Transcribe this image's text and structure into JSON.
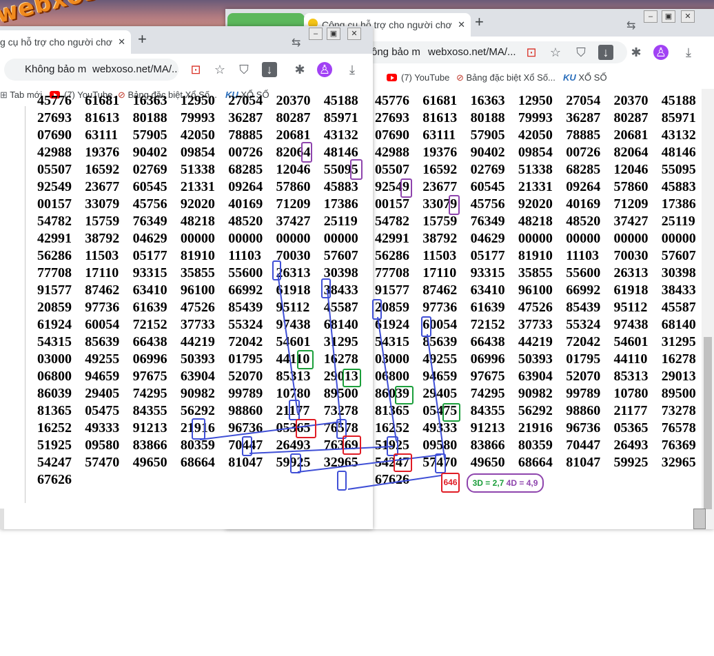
{
  "watermark": "webxoso.net",
  "back_window": {
    "tab_title": "Công cụ hỗ trợ cho người chơ",
    "tab_close": "✕",
    "new_tab": "+",
    "omnibox_left": "ông bảo m",
    "url": "webxoso.net/MA/...",
    "bookmarks": [
      "(7) YouTube",
      "Bảng đặc biệt Xổ Số...",
      "XỔ SỐ"
    ],
    "bookmark_prefix": "s"
  },
  "front_window": {
    "tab_title": "g cụ hỗ trợ cho người chơ",
    "tab_close": "✕",
    "new_tab": "+",
    "security": "Không bảo m",
    "url": "webxoso.net/MA/...",
    "bookmarks": [
      "Tab mới",
      "(7) YouTube",
      "Bảng đặc biệt Xổ Số...",
      "XỔ SỐ"
    ]
  },
  "left_grid": {
    "rows": [
      [
        "45776",
        "61681",
        "16363",
        "12950",
        "27054",
        "20370",
        "45188"
      ],
      [
        "27693",
        "81613",
        "80188",
        "79993",
        "36287",
        "80287",
        "85971"
      ],
      [
        "07690",
        "63111",
        "57905",
        "42050",
        "78885",
        "20681",
        "43132"
      ],
      [
        "42988",
        "19376",
        "90402",
        "09854",
        "00726",
        "82064",
        "48146"
      ],
      [
        "05507",
        "16592",
        "02769",
        "51338",
        "68285",
        "12046",
        "55095"
      ],
      [
        "92549",
        "23677",
        "60545",
        "21331",
        "09264",
        "57860",
        "45883"
      ],
      [
        "00157",
        "33079",
        "45756",
        "92020",
        "40169",
        "71209",
        "17386"
      ],
      [
        "54782",
        "15759",
        "76349",
        "48218",
        "48520",
        "37427",
        "25119"
      ],
      [
        "42991",
        "38792",
        "04629",
        "00000",
        "00000",
        "00000",
        "00000"
      ],
      [
        "56286",
        "11503",
        "05177",
        "81910",
        "11103",
        "70030",
        "57607"
      ],
      [
        "77708",
        "17110",
        "93315",
        "35855",
        "55600",
        "26313",
        "30398"
      ],
      [
        "91577",
        "87462",
        "63410",
        "96100",
        "66992",
        "61918",
        "38433"
      ],
      [
        "20859",
        "97736",
        "61639",
        "47526",
        "85439",
        "95112",
        "45587"
      ],
      [
        "61924",
        "60054",
        "72152",
        "37733",
        "55324",
        "97438",
        "68140"
      ],
      [
        "54315",
        "85639",
        "66438",
        "44219",
        "72042",
        "54601",
        "31295"
      ],
      [
        "03000",
        "49255",
        "06996",
        "50393",
        "01795",
        "44110",
        "16278"
      ],
      [
        "06800",
        "94659",
        "97675",
        "63904",
        "52070",
        "85313",
        "29013"
      ],
      [
        "86039",
        "29405",
        "74295",
        "90982",
        "99789",
        "10780",
        "89500"
      ],
      [
        "81365",
        "05475",
        "84355",
        "56292",
        "98860",
        "21177",
        "73278"
      ],
      [
        "16252",
        "49333",
        "91213",
        "21916",
        "96736",
        "05365",
        "76578"
      ],
      [
        "51925",
        "09580",
        "83866",
        "80359",
        "70447",
        "26493",
        "76369"
      ],
      [
        "54247",
        "57470",
        "49650",
        "68664",
        "81047",
        "59925",
        "32965"
      ],
      [
        "67626"
      ]
    ]
  },
  "right_grid": {
    "rows": [
      [
        "45776",
        "61681",
        "16363",
        "12950",
        "27054",
        "20370",
        "45188"
      ],
      [
        "27693",
        "81613",
        "80188",
        "79993",
        "36287",
        "80287",
        "85971"
      ],
      [
        "07690",
        "63111",
        "57905",
        "42050",
        "78885",
        "20681",
        "43132"
      ],
      [
        "42988",
        "19376",
        "90402",
        "09854",
        "00726",
        "82064",
        "48146"
      ],
      [
        "05507",
        "16592",
        "02769",
        "51338",
        "68285",
        "12046",
        "55095"
      ],
      [
        "92549",
        "23677",
        "60545",
        "21331",
        "09264",
        "57860",
        "45883"
      ],
      [
        "00157",
        "33079",
        "45756",
        "92020",
        "40169",
        "71209",
        "17386"
      ],
      [
        "54782",
        "15759",
        "76349",
        "48218",
        "48520",
        "37427",
        "25119"
      ],
      [
        "42991",
        "38792",
        "04629",
        "00000",
        "00000",
        "00000",
        "00000"
      ],
      [
        "56286",
        "11503",
        "05177",
        "81910",
        "11103",
        "70030",
        "57607"
      ],
      [
        "77708",
        "17110",
        "93315",
        "35855",
        "55600",
        "26313",
        "30398"
      ],
      [
        "91577",
        "87462",
        "63410",
        "96100",
        "66992",
        "61918",
        "38433"
      ],
      [
        "20859",
        "97736",
        "61639",
        "47526",
        "85439",
        "95112",
        "45587"
      ],
      [
        "61924",
        "60054",
        "72152",
        "37733",
        "55324",
        "97438",
        "68140"
      ],
      [
        "54315",
        "85639",
        "66438",
        "44219",
        "72042",
        "54601",
        "31295"
      ],
      [
        "03000",
        "49255",
        "06996",
        "50393",
        "01795",
        "44110",
        "16278"
      ],
      [
        "06800",
        "94659",
        "97675",
        "63904",
        "52070",
        "85313",
        "29013"
      ],
      [
        "86039",
        "29405",
        "74295",
        "90982",
        "99789",
        "10780",
        "89500"
      ],
      [
        "81365",
        "05475",
        "84355",
        "56292",
        "98860",
        "21177",
        "73278"
      ],
      [
        "16252",
        "49333",
        "91213",
        "21916",
        "96736",
        "05365",
        "76578"
      ],
      [
        "51925",
        "09580",
        "83866",
        "80359",
        "70447",
        "26493",
        "76369"
      ],
      [
        "54247",
        "57470",
        "49650",
        "68664",
        "81047",
        "59925",
        "32965"
      ],
      [
        "67626"
      ]
    ]
  },
  "annotation": {
    "red_box": "646",
    "note_3d": "3D = 2,7",
    "note_4d": "4D = 4,9"
  },
  "colors": {
    "purple": "#8e44ad",
    "blue": "#3f4fd6",
    "green": "#1a9e3a",
    "red": "#e01b24"
  }
}
